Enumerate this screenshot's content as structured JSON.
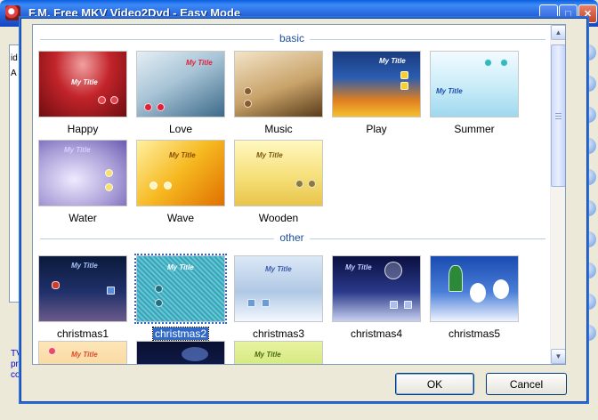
{
  "main_window": {
    "title": "F.M. Free MKV Video2Dvd - Easy Mode",
    "controls": {
      "minimize": "_",
      "maximize": "□",
      "close": "✕"
    },
    "side_fragments": [
      "id",
      "A"
    ],
    "link_fragments": [
      "TV",
      "pr",
      "co"
    ]
  },
  "dialog": {
    "sections": [
      {
        "label": "basic",
        "items": [
          {
            "label": "Happy",
            "thumb_title": "My Title",
            "selected": false
          },
          {
            "label": "Love",
            "thumb_title": "My Title",
            "selected": false
          },
          {
            "label": "Music",
            "thumb_title": "",
            "selected": false
          },
          {
            "label": "Play",
            "thumb_title": "My Title",
            "selected": false
          },
          {
            "label": "Summer",
            "thumb_title": "My Title",
            "selected": false
          },
          {
            "label": "Water",
            "thumb_title": "My Title",
            "selected": false
          },
          {
            "label": "Wave",
            "thumb_title": "My Title",
            "selected": false
          },
          {
            "label": "Wooden",
            "thumb_title": "My Title",
            "selected": false
          }
        ]
      },
      {
        "label": "other",
        "items": [
          {
            "label": "christmas1",
            "thumb_title": "My Title",
            "selected": false
          },
          {
            "label": "christmas2",
            "thumb_title": "My Title",
            "selected": true
          },
          {
            "label": "christmas3",
            "thumb_title": "My Title",
            "selected": false
          },
          {
            "label": "christmas4",
            "thumb_title": "My Title",
            "selected": false
          },
          {
            "label": "christmas5",
            "thumb_title": "",
            "selected": false
          }
        ],
        "partial_row_titles": [
          "My Title",
          "",
          "My Title"
        ]
      }
    ],
    "buttons": {
      "ok": "OK",
      "cancel": "Cancel"
    },
    "scroll_up": "▲",
    "scroll_down": "▼"
  },
  "colors": {
    "section_header": "#1a4fa0",
    "selection": "#316ac5",
    "titlebar": "#2462d8"
  }
}
